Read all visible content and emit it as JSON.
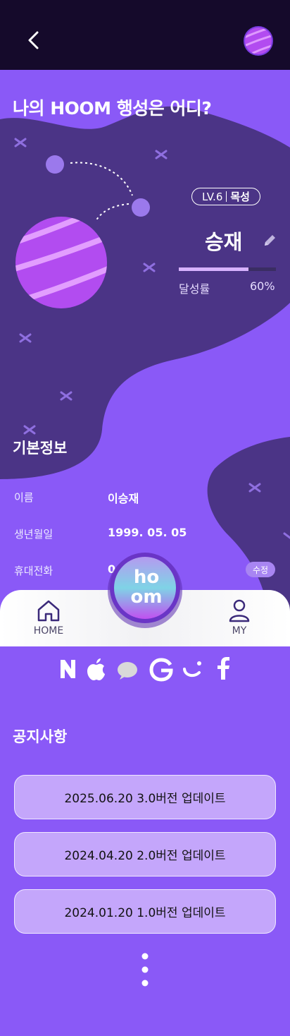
{
  "header": {
    "back_icon": "chevron-left-icon",
    "avatar_icon": "planet-avatar-icon"
  },
  "title": "나의 HOOM 행성은 어디?",
  "profile": {
    "level": "LV.6",
    "planet": "목성",
    "name": "승재",
    "progress_label": "달성률",
    "progress_text": "60%",
    "progress_fraction": 0.72
  },
  "basic_info": {
    "title": "기본정보",
    "rows": [
      {
        "label": "이름",
        "value": "이승재"
      },
      {
        "label": "생년월일",
        "value": "1999. 05. 05"
      },
      {
        "label": "휴대전화",
        "value": "0      5678"
      }
    ],
    "edit_label": "수정"
  },
  "bottom_nav": {
    "home": "HOME",
    "my": "MY"
  },
  "center_logo": {
    "line1": "ho",
    "line2": "om"
  },
  "social_icons": [
    "naver-icon",
    "apple-icon",
    "kakao-icon",
    "google-icon",
    "daum-icon",
    "facebook-icon"
  ],
  "notices": {
    "title": "공지사항",
    "items": [
      "2025.06.20 3.0버전 업데이트",
      "2024.04.20 2.0버전 업데이트",
      "2024.01.20 1.0버전 업데이트"
    ]
  },
  "colors": {
    "background": "#8a59f7",
    "dark_blob": "#4b3486",
    "topbar": "#150a2b",
    "card": "#c4a6fb"
  }
}
